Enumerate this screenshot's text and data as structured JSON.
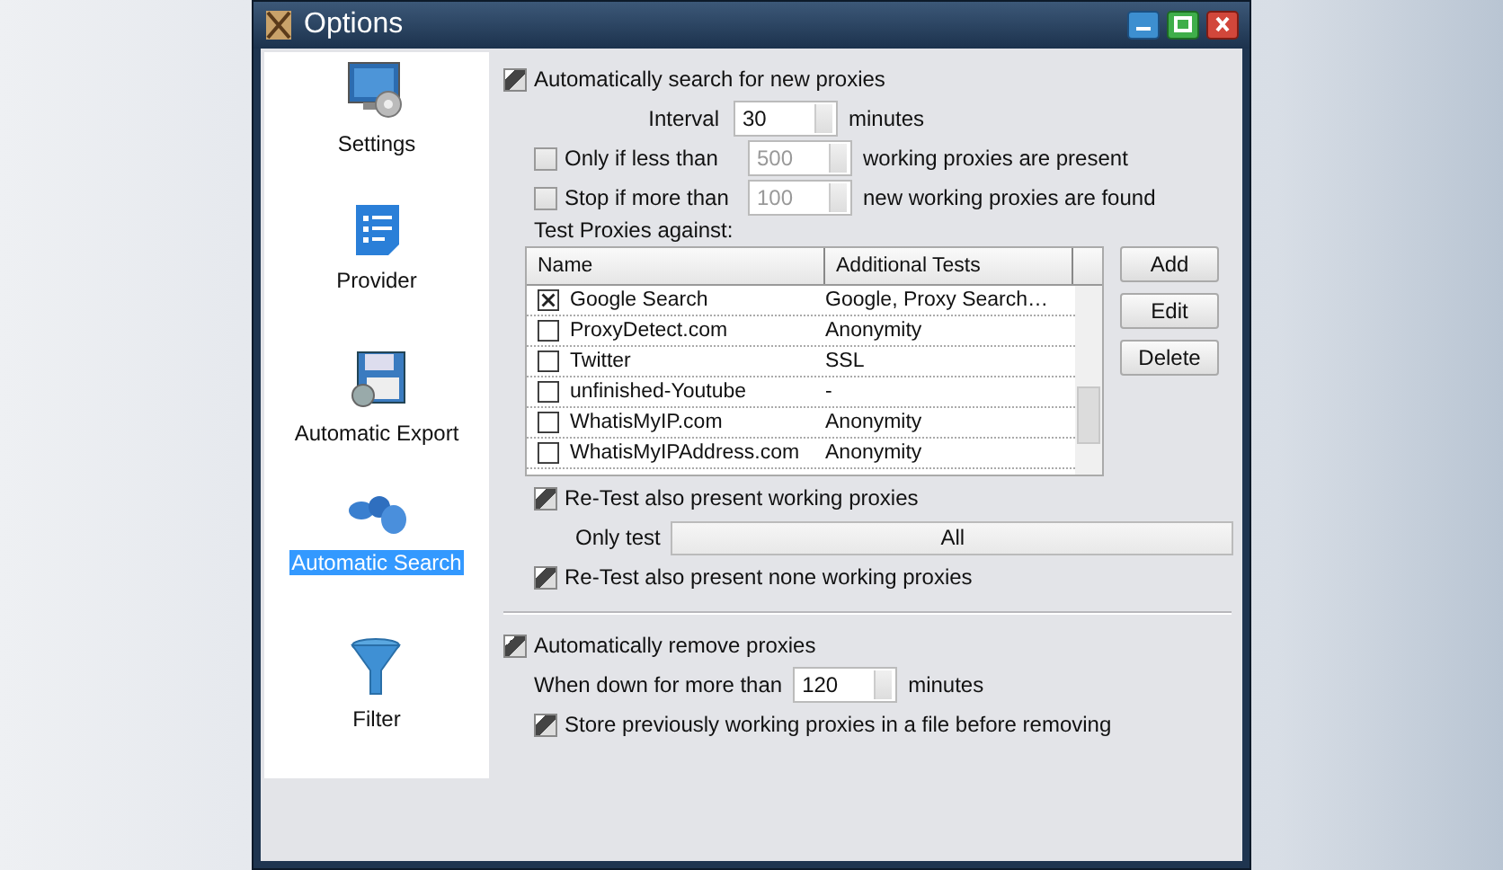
{
  "window": {
    "title": "Options"
  },
  "sidebar": {
    "items": [
      {
        "label": "Settings",
        "selected": false
      },
      {
        "label": "Provider",
        "selected": false
      },
      {
        "label": "Automatic Export",
        "selected": false
      },
      {
        "label": "Automatic Search",
        "selected": true
      },
      {
        "label": "Filter",
        "selected": false
      }
    ]
  },
  "auto_search": {
    "label": "Automatically search for new proxies",
    "checked": true,
    "interval": {
      "label": "Interval",
      "value": "30",
      "unit": "minutes"
    },
    "only_if_less": {
      "label": "Only if less than",
      "checked": false,
      "value": "500",
      "unit": "working proxies are present"
    },
    "stop_if_more": {
      "label": "Stop if more than",
      "checked": false,
      "value": "100",
      "unit": "new working proxies are found"
    },
    "test_label": "Test Proxies against:",
    "table": {
      "columns": [
        "Name",
        "Additional Tests"
      ],
      "rows": [
        {
          "name": "Google Search",
          "tests": "Google, Proxy Search…",
          "checked": true
        },
        {
          "name": "ProxyDetect.com",
          "tests": "Anonymity",
          "checked": false
        },
        {
          "name": "Twitter",
          "tests": "SSL",
          "checked": false
        },
        {
          "name": "unfinished-Youtube",
          "tests": "-",
          "checked": false
        },
        {
          "name": "WhatisMyIP.com",
          "tests": "Anonymity",
          "checked": false
        },
        {
          "name": "WhatisMyIPAddress.com",
          "tests": "Anonymity",
          "checked": false
        }
      ]
    },
    "buttons": [
      "Add",
      "Edit",
      "Delete"
    ],
    "retest_working": {
      "label": "Re-Test also present working proxies",
      "checked": true
    },
    "only_test": {
      "label": "Only test",
      "value": "All"
    },
    "retest_none": {
      "label": "Re-Test also present none working proxies",
      "checked": true
    }
  },
  "auto_remove": {
    "label": "Automatically remove proxies",
    "checked": true,
    "when_down": {
      "label": "When down for more than",
      "value": "120",
      "unit": "minutes"
    },
    "store": {
      "label": "Store previously working proxies in a file before removing",
      "checked": true
    }
  }
}
